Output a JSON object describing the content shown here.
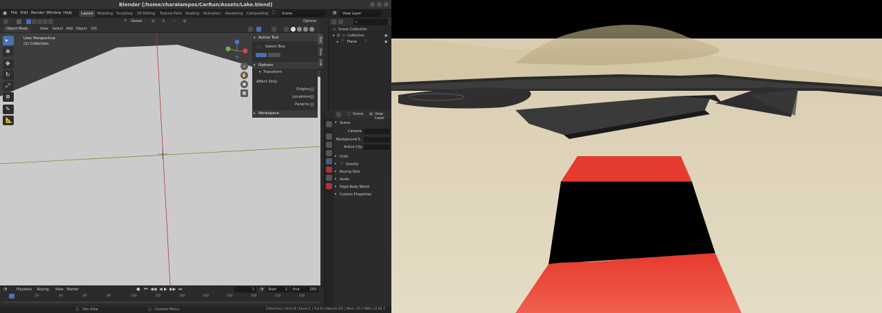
{
  "window": {
    "title": "Blender [/home/charalampos/CarRun/Assets/Lake.blend]"
  },
  "menu": {
    "items": [
      "File",
      "Edit",
      "Render",
      "Window",
      "Help"
    ],
    "workspaces": [
      "Layout",
      "Modeling",
      "Sculpting",
      "UV Editing",
      "Texture Paint",
      "Shading",
      "Animation",
      "Rendering",
      "Compositing"
    ],
    "scene": "Scene",
    "view_layer": "View Layer"
  },
  "tool_header": {
    "orientation": "Global",
    "options": "Options"
  },
  "view_header": {
    "mode": "Object Mode",
    "items": [
      "View",
      "Select",
      "Add",
      "Object",
      "GIS"
    ]
  },
  "viewport": {
    "perspective": "User Perspective",
    "collection": "(1) Collection"
  },
  "n_panel": {
    "active_tool": "Active Tool",
    "select_box": "Select Box",
    "options": "Options",
    "transform": "Transform",
    "affect_only": "Affect Only",
    "origins": "Origins",
    "locations": "Locations",
    "parents": "Parents",
    "workspace": "Workspace",
    "tabs": [
      "Tool",
      "View",
      "Edit"
    ]
  },
  "outliner": {
    "rows": [
      "Scene Collection",
      "Collection",
      "Plane"
    ]
  },
  "properties": {
    "scene_label": "Scene",
    "view_layer": "View Layer",
    "section": "Scene",
    "camera": "Camera",
    "background": "Background S.",
    "active_clip": "Active Clip",
    "panels": [
      "Units",
      "Gravity",
      "Keying Sets",
      "Audio",
      "Rigid Body World",
      "Custom Properties"
    ]
  },
  "timeline": {
    "menus": [
      "Playback",
      "Keying",
      "View",
      "Marker"
    ],
    "current_frame": "1",
    "start_label": "Start",
    "start": "1",
    "end_label": "End",
    "end": "250",
    "ticks": [
      "1",
      "20",
      "40",
      "60",
      "80",
      "100",
      "120",
      "140",
      "160",
      "180",
      "200",
      "220",
      "240"
    ]
  },
  "statusbar": {
    "pan": "Pan View",
    "context": "Context Menu",
    "stats": "Collection | Verts:8 | Faces:1 | Tris:0 | Objects:0/1 | Mem: 25.7 MiB | v2.82.7"
  },
  "colors": {
    "accent": "#4772b3",
    "sand": "#e1d6bc",
    "car": "#f2473a",
    "x_axis": "#b8383d",
    "y_axis": "#6a9a2a"
  }
}
